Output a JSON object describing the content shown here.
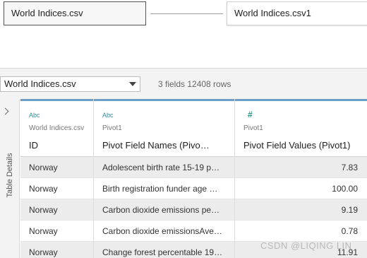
{
  "flow": {
    "left_node": "World Indices.csv",
    "right_node": "World Indices.csv1"
  },
  "toolbar": {
    "datasource": "World Indices.csv",
    "summary": "3 fields 12408 rows"
  },
  "side_panel": {
    "label": "Table Details"
  },
  "columns": [
    {
      "type": "Abc",
      "origin": "World Indices.csv",
      "name": "ID"
    },
    {
      "type": "Abc",
      "origin": "Pivot1",
      "name": "Pivot Field Names (Pivo…"
    },
    {
      "type": "#",
      "origin": "Pivot1",
      "name": "Pivot Field Values (Pivot1)"
    }
  ],
  "rows": [
    {
      "id": "Norway",
      "name": "Adolescent birth rate 15-19 p…",
      "value": "7.83"
    },
    {
      "id": "Norway",
      "name": "Birth registration funder age …",
      "value": "100.00"
    },
    {
      "id": "Norway",
      "name": "Carbon dioxide emissions pe…",
      "value": "9.19"
    },
    {
      "id": "Norway",
      "name": "Carbon dioxide emissionsAve…",
      "value": "0.78"
    },
    {
      "id": "Norway",
      "name": "Change forest percentable 19…",
      "value": "11.91"
    }
  ],
  "watermark": "CSDN @LIQING LIN"
}
